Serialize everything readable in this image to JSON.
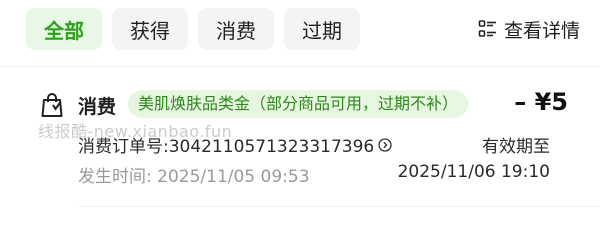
{
  "tabs": [
    {
      "label": "全部",
      "active": true
    },
    {
      "label": "获得",
      "active": false
    },
    {
      "label": "消费",
      "active": false
    },
    {
      "label": "过期",
      "active": false
    }
  ],
  "header": {
    "details_label": "查看详情",
    "details_icon": "list-icon"
  },
  "record": {
    "type": "消费",
    "coupon": "美肌焕肤品类金（部分商品可用，过期不补）",
    "amount": "– ¥5",
    "order_label": "消费订单号:3042110571323317396",
    "valid_label": "有效期至",
    "time_label": "发生时间: 2025/11/05 09:53",
    "expire_time": "2025/11/06 19:10"
  },
  "watermark": "线报酷-new.xianbao.fun",
  "colors": {
    "accent": "#2aa316",
    "tag_bg": "#e6f6e0",
    "tab_bg": "#f3f4f6"
  }
}
